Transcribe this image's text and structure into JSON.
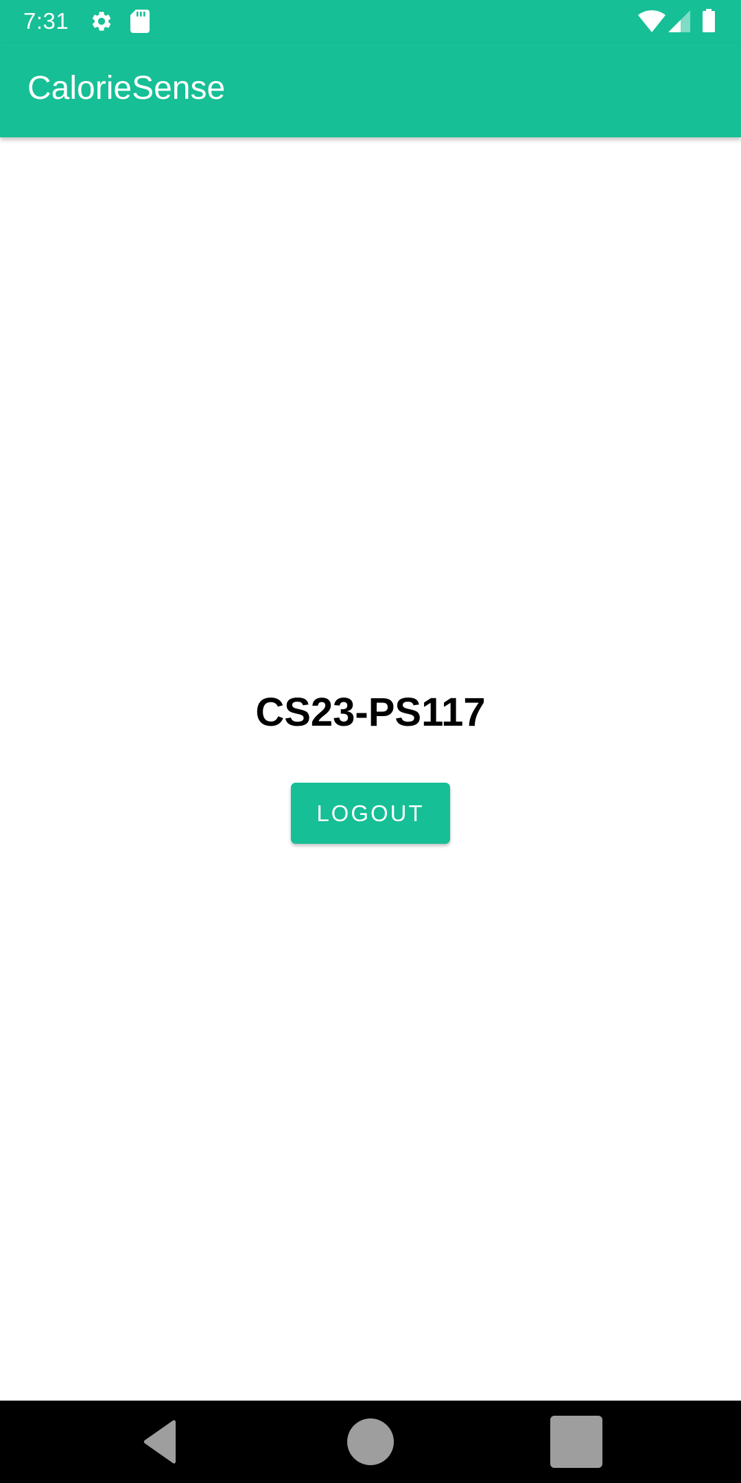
{
  "status_bar": {
    "time": "7:31",
    "icons": [
      "gear-icon",
      "sd-card-icon",
      "wifi-icon",
      "signal-icon",
      "battery-icon"
    ]
  },
  "app_bar": {
    "title": "CalorieSense"
  },
  "main": {
    "title": "CS23-PS117",
    "logout_label": "LOGOUT"
  },
  "nav_bar": {
    "buttons": [
      "back-icon",
      "home-icon",
      "recents-icon"
    ]
  },
  "colors": {
    "primary": "#16bf96",
    "background": "#ffffff",
    "text": "#000000",
    "nav_background": "#000000",
    "nav_icon": "#9e9e9e"
  }
}
